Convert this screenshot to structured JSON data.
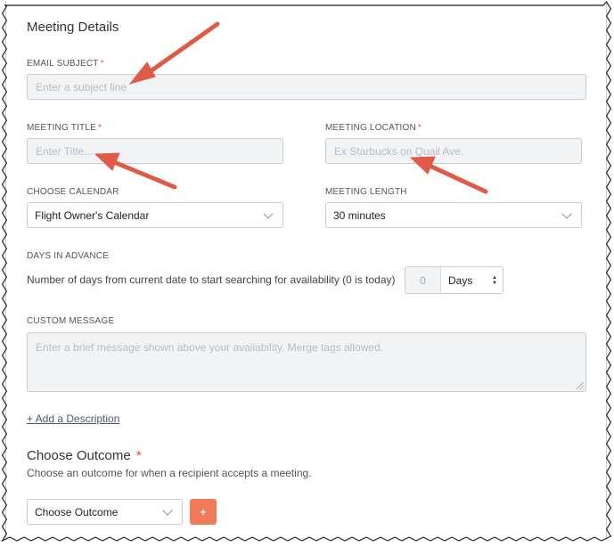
{
  "section": {
    "title": "Meeting Details"
  },
  "email_subject": {
    "label": "EMAIL SUBJECT",
    "required": "*",
    "placeholder": "Enter a subject line"
  },
  "meeting_title": {
    "label": "MEETING TITLE",
    "required": "*",
    "placeholder": "Enter Title..."
  },
  "meeting_location": {
    "label": "MEETING LOCATION",
    "required": "*",
    "placeholder": "Ex Starbucks on Quail Ave."
  },
  "choose_calendar": {
    "label": "CHOOSE CALENDAR",
    "value": "Flight Owner's Calendar"
  },
  "meeting_length": {
    "label": "MEETING LENGTH",
    "value": "30 minutes"
  },
  "days_in_advance": {
    "label": "DAYS IN ADVANCE",
    "description": "Number of days from current date to start searching for availability (0 is today)",
    "value": "0",
    "unit": "Days"
  },
  "custom_message": {
    "label": "CUSTOM MESSAGE",
    "placeholder": "Enter a brief message shown above your availability. Merge tags allowed."
  },
  "add_description": "+ Add a Description",
  "outcome": {
    "title": "Choose Outcome",
    "required": "*",
    "subtitle": "Choose an outcome for when a recipient accepts a meeting.",
    "select_value": "Choose Outcome",
    "plus_label": "+"
  },
  "colors": {
    "accent": "#f07a5a",
    "required": "#e5533d",
    "arrow": "#e05a47"
  }
}
